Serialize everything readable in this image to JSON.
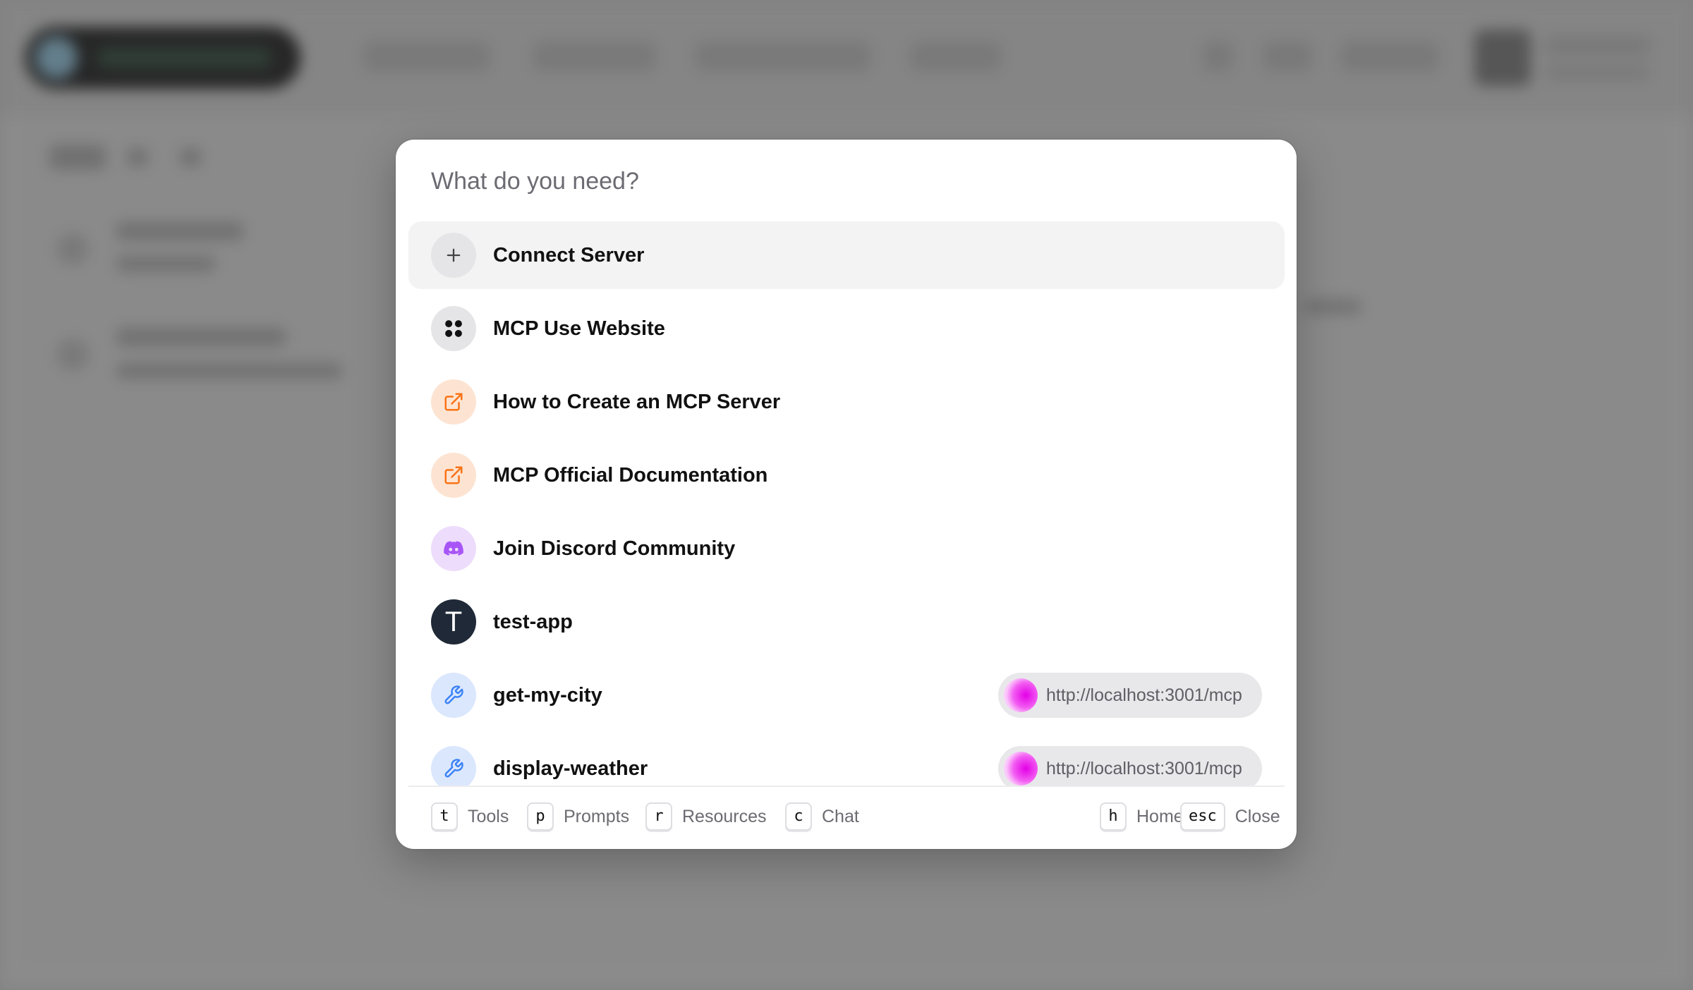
{
  "search": {
    "placeholder": "What do you need?"
  },
  "items": [
    {
      "label": "Connect Server",
      "icon": "plus-icon",
      "icon_bg": "#e5e5e8",
      "active": true
    },
    {
      "label": "MCP Use Website",
      "icon": "mcp-logo-icon",
      "icon_bg": "#e5e5e8"
    },
    {
      "label": "How to Create an MCP Server",
      "icon": "external-link-icon",
      "icon_bg": "#fde4d2",
      "icon_color": "#f97316"
    },
    {
      "label": "MCP Official Documentation",
      "icon": "external-link-icon",
      "icon_bg": "#fde4d2",
      "icon_color": "#f97316"
    },
    {
      "label": "Join Discord Community",
      "icon": "discord-icon",
      "icon_bg": "#eddcfb",
      "icon_color": "#a855f7"
    },
    {
      "label": "test-app",
      "icon": "app-avatar-icon",
      "icon_bg": "#1f2937",
      "avatar_letter": "T"
    },
    {
      "label": "get-my-city",
      "icon": "wrench-icon",
      "icon_bg": "#dbe7fd",
      "icon_color": "#3b82f6",
      "server": "http://localhost:3001/mcp"
    },
    {
      "label": "display-weather",
      "icon": "wrench-icon",
      "icon_bg": "#dbe7fd",
      "icon_color": "#3b82f6",
      "server": "http://localhost:3001/mcp"
    }
  ],
  "footer": {
    "left": [
      {
        "key": "t",
        "label": "Tools"
      },
      {
        "key": "p",
        "label": "Prompts"
      },
      {
        "key": "r",
        "label": "Resources"
      },
      {
        "key": "c",
        "label": "Chat"
      }
    ],
    "right": [
      {
        "key": "h",
        "label": "Home"
      },
      {
        "key": "esc",
        "label": "Close"
      }
    ]
  }
}
